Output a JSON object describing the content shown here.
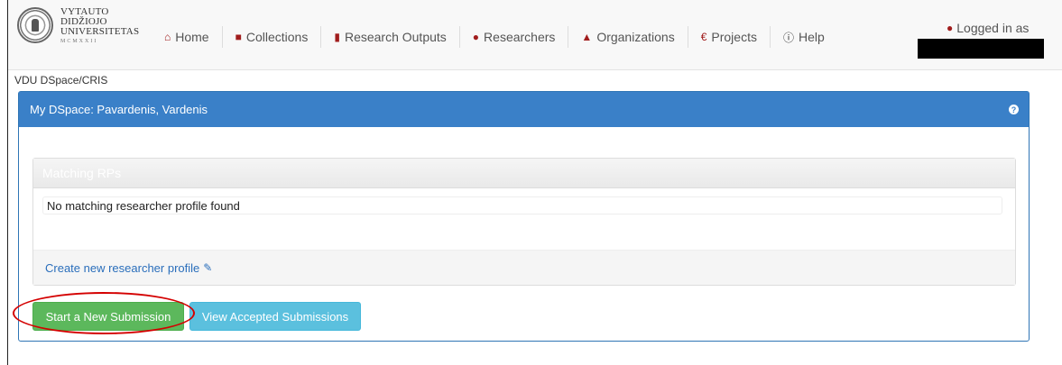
{
  "logo": {
    "line1": "VYTAUTO",
    "line2": "DIDŽIOJO",
    "line3": "UNIVERSITETAS",
    "line4": "MCMXXII"
  },
  "nav": {
    "items": [
      {
        "label": "Home",
        "icon": "home-icon"
      },
      {
        "label": "Collections",
        "icon": "folder-icon"
      },
      {
        "label": "Research Outputs",
        "icon": "book-icon"
      },
      {
        "label": "Researchers",
        "icon": "user-icon"
      },
      {
        "label": "Organizations",
        "icon": "institution-icon"
      },
      {
        "label": "Projects",
        "icon": "euro-icon"
      },
      {
        "label": "Help",
        "icon": "info-icon"
      }
    ],
    "login_label": "Logged in as"
  },
  "breadcrumb": "VDU DSpace/CRIS",
  "panel": {
    "title": "My DSpace: Pavardenis, Vardenis",
    "matching": {
      "title": "Matching RPs",
      "message": "No matching researcher profile found",
      "create_link": "Create new researcher profile"
    },
    "buttons": {
      "start": "Start a New Submission",
      "view": "View Accepted Submissions"
    }
  },
  "colors": {
    "panel_header": "#3a80c8",
    "start_button": "#5cb85c",
    "view_button": "#5bc0de",
    "highlight_ring": "#d40000",
    "nav_icon": "#a11d1d"
  }
}
